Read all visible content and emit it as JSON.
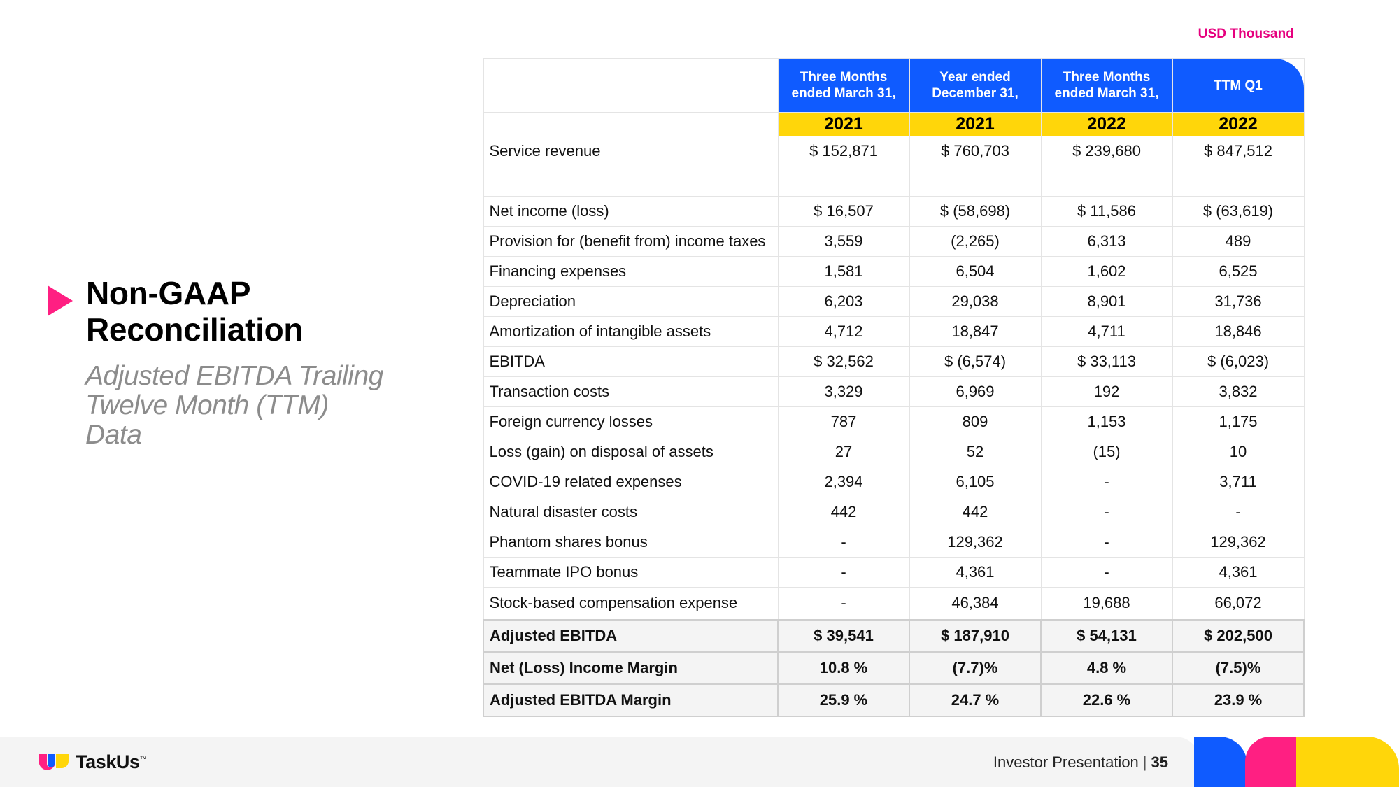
{
  "units_label": "USD Thousand",
  "title": "Non-GAAP Reconciliation",
  "subtitle": "Adjusted EBITDA Trailing Twelve Month (TTM) Data",
  "columns": [
    {
      "header_line1": "Three Months",
      "header_line2": "ended March 31,",
      "year": "2021"
    },
    {
      "header_line1": "Year ended",
      "header_line2": "December 31,",
      "year": "2021"
    },
    {
      "header_line1": "Three Months",
      "header_line2": "ended March 31,",
      "year": "2022"
    },
    {
      "header_line1": "TTM Q1",
      "header_line2": "",
      "year": "2022"
    }
  ],
  "rows": [
    {
      "label": "Service revenue",
      "values": [
        "$ 152,871",
        "$ 760,703",
        "$ 239,680",
        "$ 847,512"
      ]
    },
    {
      "label": "",
      "values": [
        "",
        "",
        "",
        ""
      ]
    },
    {
      "label": "Net income (loss)",
      "values": [
        "$ 16,507",
        "$ (58,698)",
        "$ 11,586",
        "$ (63,619)"
      ]
    },
    {
      "label": "Provision for (benefit from) income taxes",
      "values": [
        "3,559",
        "(2,265)",
        "6,313",
        "489"
      ]
    },
    {
      "label": "Financing expenses",
      "values": [
        "1,581",
        "6,504",
        "1,602",
        "6,525"
      ]
    },
    {
      "label": "Depreciation",
      "values": [
        "6,203",
        "29,038",
        "8,901",
        "31,736"
      ]
    },
    {
      "label": "Amortization of intangible assets",
      "values": [
        "4,712",
        "18,847",
        "4,711",
        "18,846"
      ]
    },
    {
      "label": "EBITDA",
      "values": [
        "$ 32,562",
        "$ (6,574)",
        "$ 33,113",
        "$ (6,023)"
      ]
    },
    {
      "label": "Transaction costs",
      "values": [
        "3,329",
        "6,969",
        "192",
        "3,832"
      ]
    },
    {
      "label": "Foreign currency losses",
      "values": [
        "787",
        "809",
        "1,153",
        "1,175"
      ]
    },
    {
      "label": "Loss (gain) on disposal of assets",
      "values": [
        "27",
        "52",
        "(15)",
        "10"
      ]
    },
    {
      "label": "COVID-19 related expenses",
      "values": [
        "2,394",
        "6,105",
        "-",
        "3,711"
      ]
    },
    {
      "label": "Natural disaster costs",
      "values": [
        "442",
        "442",
        "-",
        "-"
      ]
    },
    {
      "label": "Phantom shares bonus",
      "values": [
        "-",
        "129,362",
        "-",
        "129,362"
      ]
    },
    {
      "label": "Teammate IPO bonus",
      "values": [
        "-",
        "4,361",
        "-",
        "4,361"
      ]
    },
    {
      "label": "Stock-based compensation expense",
      "values": [
        "-",
        "46,384",
        "19,688",
        "66,072"
      ]
    }
  ],
  "totals": [
    {
      "label": "Adjusted EBITDA",
      "values": [
        "$ 39,541",
        "$ 187,910",
        "$ 54,131",
        "$ 202,500"
      ]
    },
    {
      "label": "Net (Loss) Income Margin",
      "values": [
        "10.8 %",
        "(7.7)%",
        "4.8 %",
        "(7.5)%"
      ]
    },
    {
      "label": "Adjusted EBITDA Margin",
      "values": [
        "25.9 %",
        "24.7 %",
        "22.6 %",
        "23.9 %"
      ]
    }
  ],
  "footer": {
    "brand": "TaskUs",
    "brand_mark": "™",
    "presentation": "Investor Presentation",
    "separator": "|",
    "page": "35"
  },
  "colors": {
    "blue": "#0f5bff",
    "yellow": "#ffd60a",
    "pink": "#ff1f82",
    "magenta_text": "#e6007e"
  },
  "icons": [
    "play-triangle-icon",
    "taskus-logo-icon"
  ]
}
